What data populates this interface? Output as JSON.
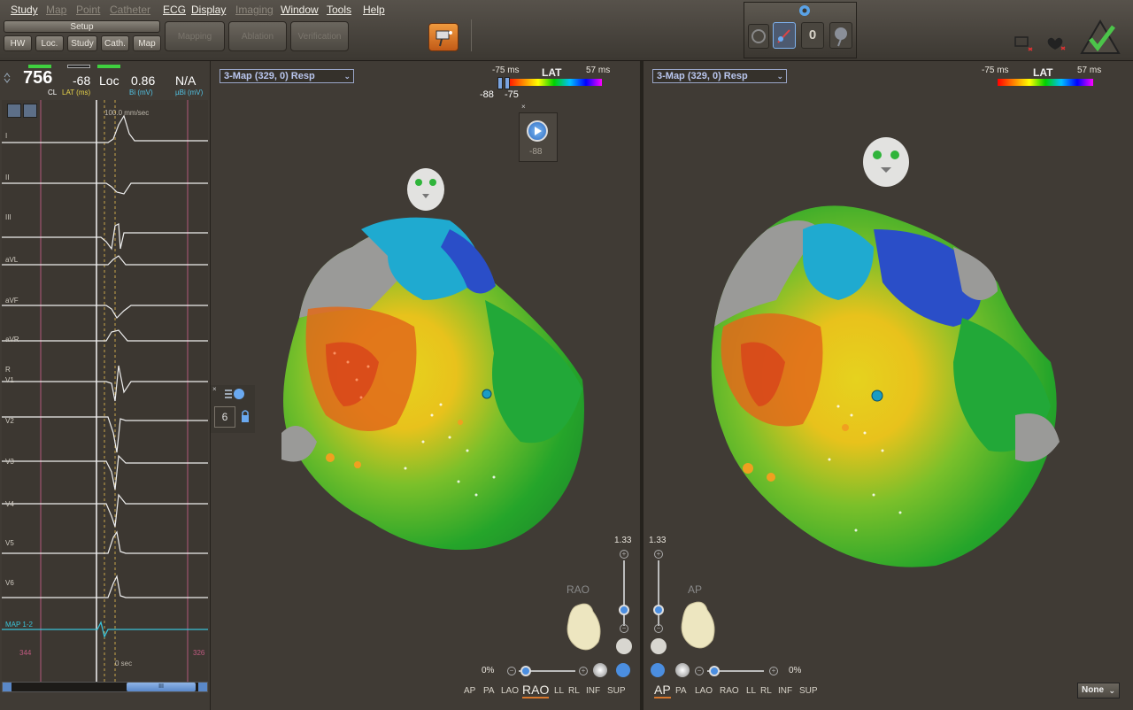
{
  "menu": {
    "items": [
      {
        "label": "Study",
        "enabled": true
      },
      {
        "label": "Map",
        "enabled": false
      },
      {
        "label": "Point",
        "enabled": false
      },
      {
        "label": "Catheter",
        "enabled": false
      },
      {
        "label": "ECG",
        "enabled": true
      },
      {
        "label": "Display",
        "enabled": true
      },
      {
        "label": "Imaging",
        "enabled": false
      },
      {
        "label": "Window",
        "enabled": true
      },
      {
        "label": "Tools",
        "enabled": true
      },
      {
        "label": "Help",
        "enabled": true
      }
    ]
  },
  "toolbar": {
    "setup_label": "Setup",
    "tabs": [
      "HW",
      "Loc.",
      "Study",
      "Cath.",
      "Map"
    ],
    "workflow": [
      "Mapping",
      "Ablation",
      "Verification"
    ],
    "point_count": "0"
  },
  "readout": {
    "cl_value": "756",
    "cl_label": "CL",
    "lat_value": "-68",
    "lat_label": "LAT (ms)",
    "loc_label": "Loc",
    "bi_value": "0.86",
    "bi_label": "Bi (mV)",
    "ubi_value": "N/A",
    "ubi_label": "µBi (mV)"
  },
  "ecg": {
    "sweep": "100.0 mm/sec",
    "leads": [
      "I",
      "II",
      "III",
      "aVL",
      "aVF",
      "aVR",
      "R",
      "V1",
      "V2",
      "V3",
      "V4",
      "V5",
      "V6"
    ],
    "map_lead": "MAP 1-2",
    "left_marker": "344",
    "right_marker": "326",
    "time_label": "0 sec",
    "scroll_label": "III"
  },
  "left_view": {
    "map_select": "3-Map (329, 0) Resp",
    "lat_min": "-75 ms",
    "lat_max": "57 ms",
    "lat_title": "LAT",
    "range_low": "-88",
    "range_high": "-75",
    "play_value": "-88",
    "zoom": "1.33",
    "orientation_label": "RAO",
    "rotation": "0%",
    "views": [
      "AP",
      "PA",
      "LAO",
      "RAO",
      "LL",
      "RL",
      "INF",
      "SUP"
    ],
    "selected_view": "RAO"
  },
  "right_view": {
    "map_select": "3-Map (329, 0) Resp",
    "lat_min": "-75 ms",
    "lat_max": "57 ms",
    "lat_title": "LAT",
    "zoom": "1.33",
    "orientation_label": "AP",
    "rotation": "0%",
    "views": [
      "AP",
      "PA",
      "LAO",
      "RAO",
      "LL",
      "RL",
      "INF",
      "SUP"
    ],
    "selected_view": "AP"
  },
  "side_tool": {
    "count": "6"
  },
  "footer": {
    "none_select": "None"
  }
}
